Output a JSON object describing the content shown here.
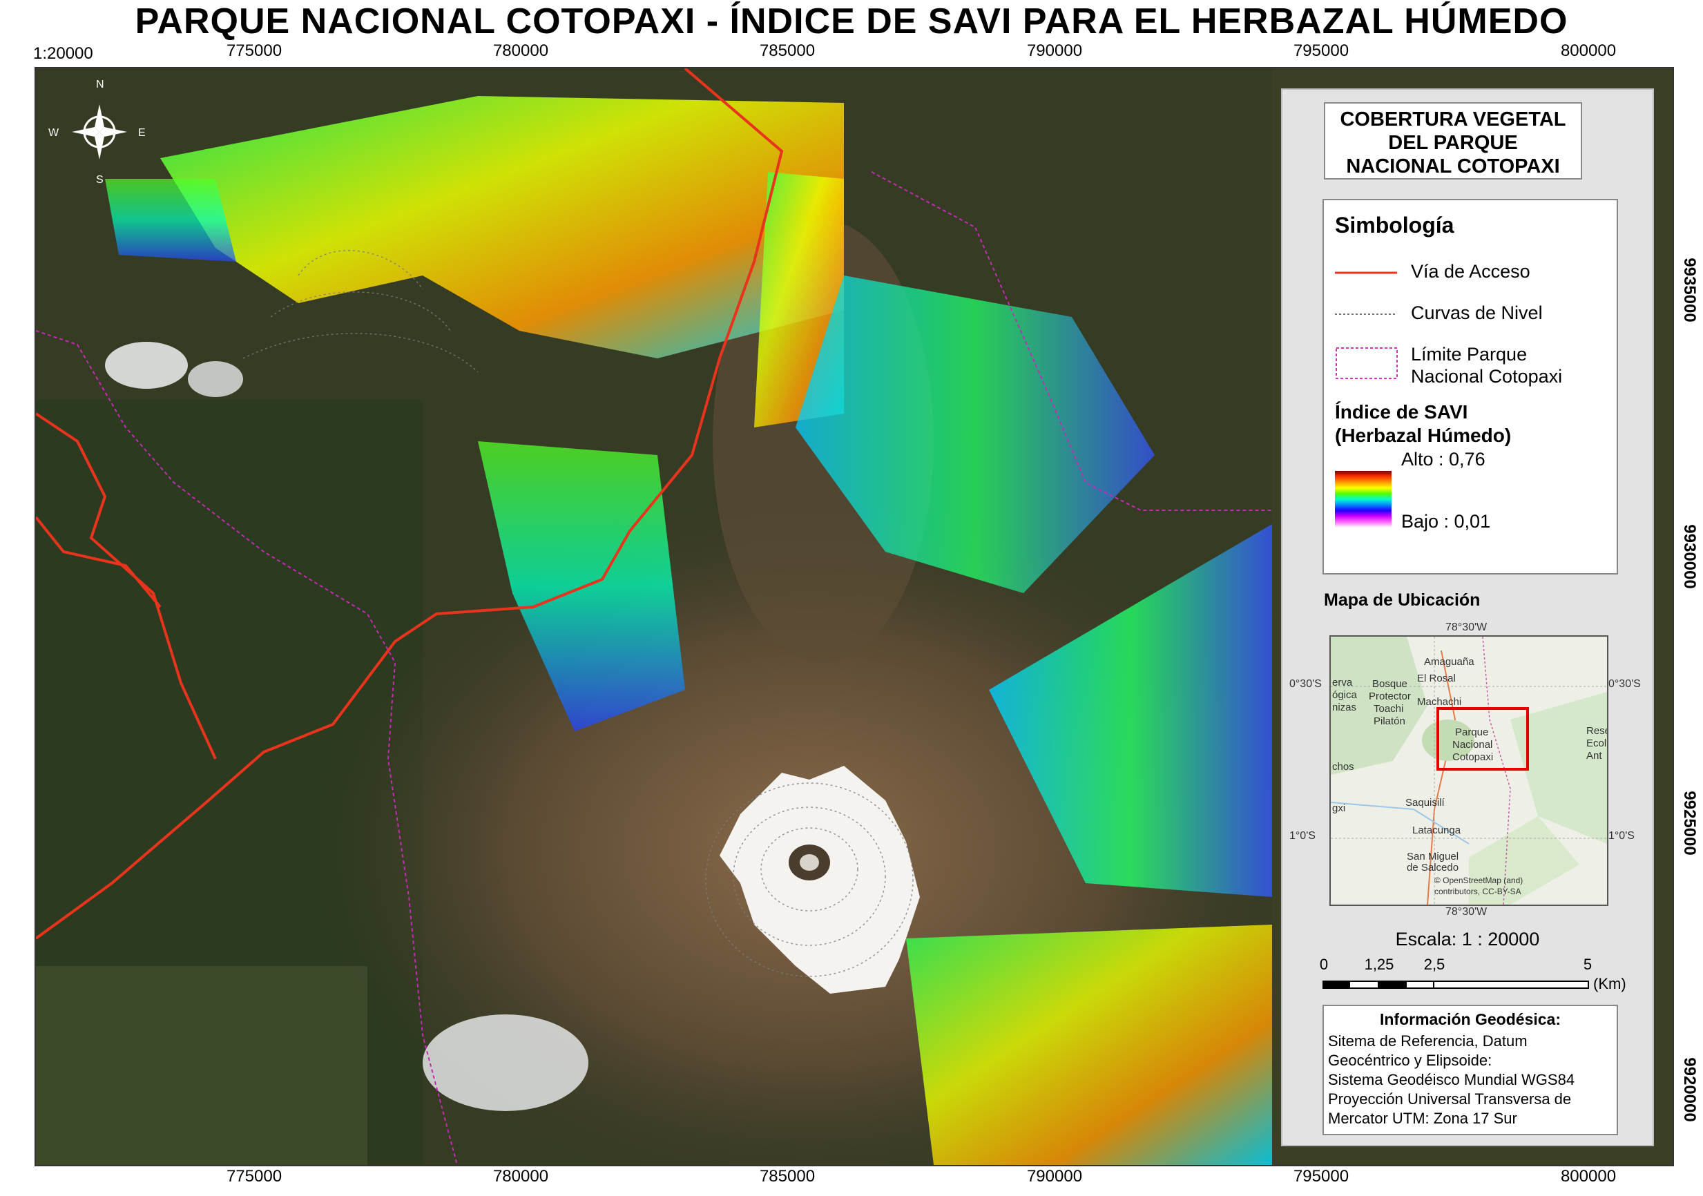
{
  "title": "PARQUE NACIONAL COTOPAXI -  ÍNDICE DE SAVI PARA EL HERBAZAL HÚMEDO",
  "scale_topleft": "1:20000",
  "x_ticks": [
    "775000",
    "780000",
    "785000",
    "790000",
    "795000",
    "800000"
  ],
  "y_ticks": [
    "9935000",
    "9930000",
    "9925000",
    "9920000"
  ],
  "compass": {
    "n": "N",
    "s": "S",
    "e": "E",
    "w": "W"
  },
  "legend": {
    "coverage_title": [
      "COBERTURA VEGETAL",
      "DEL PARQUE",
      "NACIONAL COTOPAXI"
    ],
    "symbology_title": "Simbología",
    "items": [
      {
        "label": "Vía de Acceso",
        "color": "#e8341c",
        "icon": "red-line"
      },
      {
        "label": "Curvas de Nivel",
        "color": "#777777",
        "icon": "dotted-line"
      },
      {
        "label": "Límite Parque",
        "label2": "Nacional Cotopaxi",
        "color": "#d633c0",
        "icon": "dotted-box"
      }
    ],
    "savi_title": [
      "Índice de SAVI",
      "(Herbazal Húmedo)"
    ],
    "savi_high": "Alto : 0,76",
    "savi_low": "Bajo : 0,01",
    "location_title": "Mapa de Ubicación",
    "inset_labels": {
      "top_lon": "78°30'W",
      "bottom_lon": "78°30'W",
      "left_lat_1": "0°30'S",
      "left_lat_2": "1°0'S",
      "right_lat_1": "0°30'S",
      "right_lat_2": "1°0'S",
      "amaguana": "Amaguaña",
      "el_rosal": "El Rosal",
      "machachi": "Machachi",
      "bosque": "Bosque",
      "protector": "Protector",
      "toachi": "Toachi",
      "pilaton": "Pilatón",
      "parque": "Parque",
      "nacional": "Nacional",
      "cotopaxi": "Cotopaxi",
      "saquisili": "Saquisilí",
      "latacunga": "Latacunga",
      "san_miguel": "San Miguel",
      "de_salcedo": "de Salcedo",
      "attribution_1": "© OpenStreetMap (and)",
      "attribution_2": "contributors, CC-BY-SA",
      "reserva_1": "Rese",
      "reserva_2": "Ecol",
      "reserva_3": "Ant",
      "edge_1": "erva",
      "edge_2": "ógica",
      "edge_3": "nizas",
      "edge_4": "chos",
      "edge_5": "gxi"
    },
    "scale_text": "Escala: 1 : 20000",
    "bar_labels": [
      "0",
      "1,25",
      "2,5",
      "5"
    ],
    "bar_unit": "(Km)",
    "geodesic_title": "Información Geodésica:",
    "geodesic_lines": [
      "Sitema de Referencia, Datum",
      "Geocéntrico y Elipsoide:",
      "Sistema Geodéisco Mundial WGS84",
      "Proyección Universal Transversa de",
      "Mercator UTM:  Zona 17 Sur"
    ]
  },
  "colors": {
    "road": "#e8341c",
    "boundary": "#c62ab8",
    "extent_box": "#e00000",
    "background_satellite": "#3a3f26",
    "snow": "#f4f3ef"
  }
}
